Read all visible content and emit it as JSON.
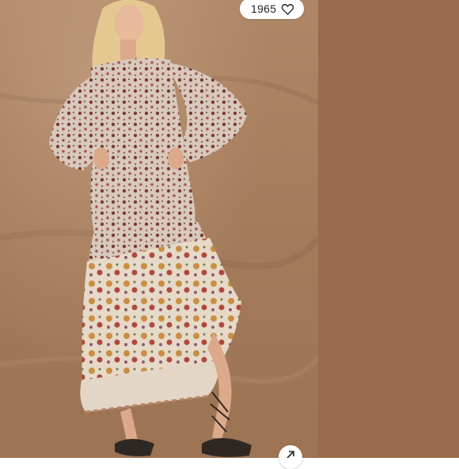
{
  "listing": {
    "likes_count": "1965"
  },
  "icons": {
    "like": "heart-outline-icon",
    "expand": "arrow-up-right-icon"
  },
  "colors": {
    "photo_backdrop": "#a67c5b",
    "side_panel": "#9a6a4c",
    "pill_background": "#ffffff"
  }
}
